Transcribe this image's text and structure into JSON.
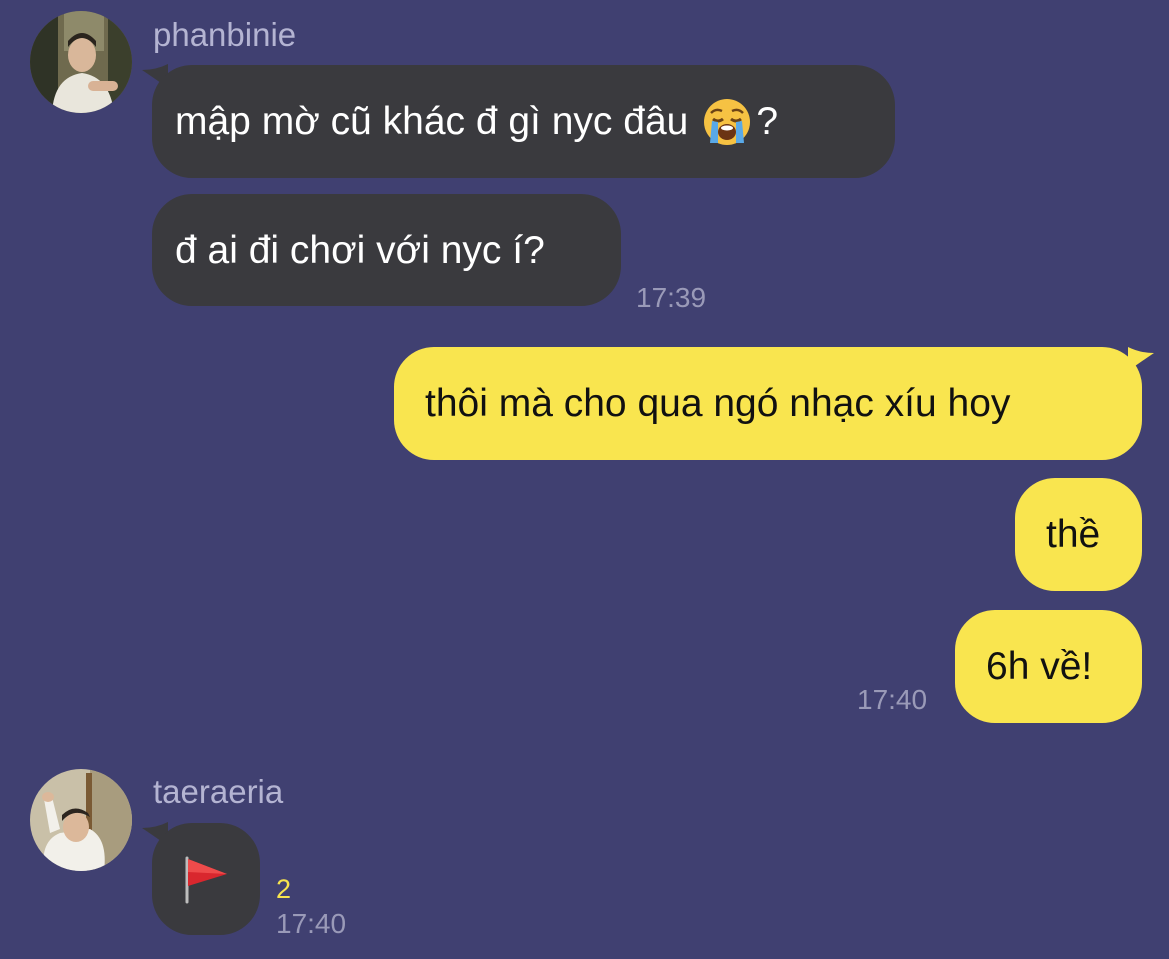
{
  "conversation": {
    "group_1": {
      "sender": "phanbinie",
      "avatar_icon": "avatar-phanbinie",
      "messages": [
        {
          "text": "mập mờ cũ khác đ gì nyc đâu",
          "emoji": "loudly-crying-face-icon",
          "after_emoji": "?"
        },
        {
          "text": "đ ai đi chơi với nyc í?"
        }
      ],
      "time": "17:39"
    },
    "group_2": {
      "messages": [
        {
          "text": "thôi mà cho qua ngó nhạc xíu hoy"
        },
        {
          "text": "thề"
        },
        {
          "text": "6h về!"
        }
      ],
      "time": "17:40"
    },
    "group_3": {
      "sender": "taeraeria",
      "avatar_icon": "avatar-taeraeria",
      "messages": [
        {
          "emoji": "red-flag-icon"
        }
      ],
      "unread_count": "2",
      "time": "17:40"
    }
  },
  "colors": {
    "background": "#404071",
    "incoming_bubble": "#3a3a3e",
    "outgoing_bubble": "#f9e54f",
    "sender_name": "#b4b4d2",
    "timestamp": "#9a9ab8",
    "unread_count": "#f7e34e"
  }
}
